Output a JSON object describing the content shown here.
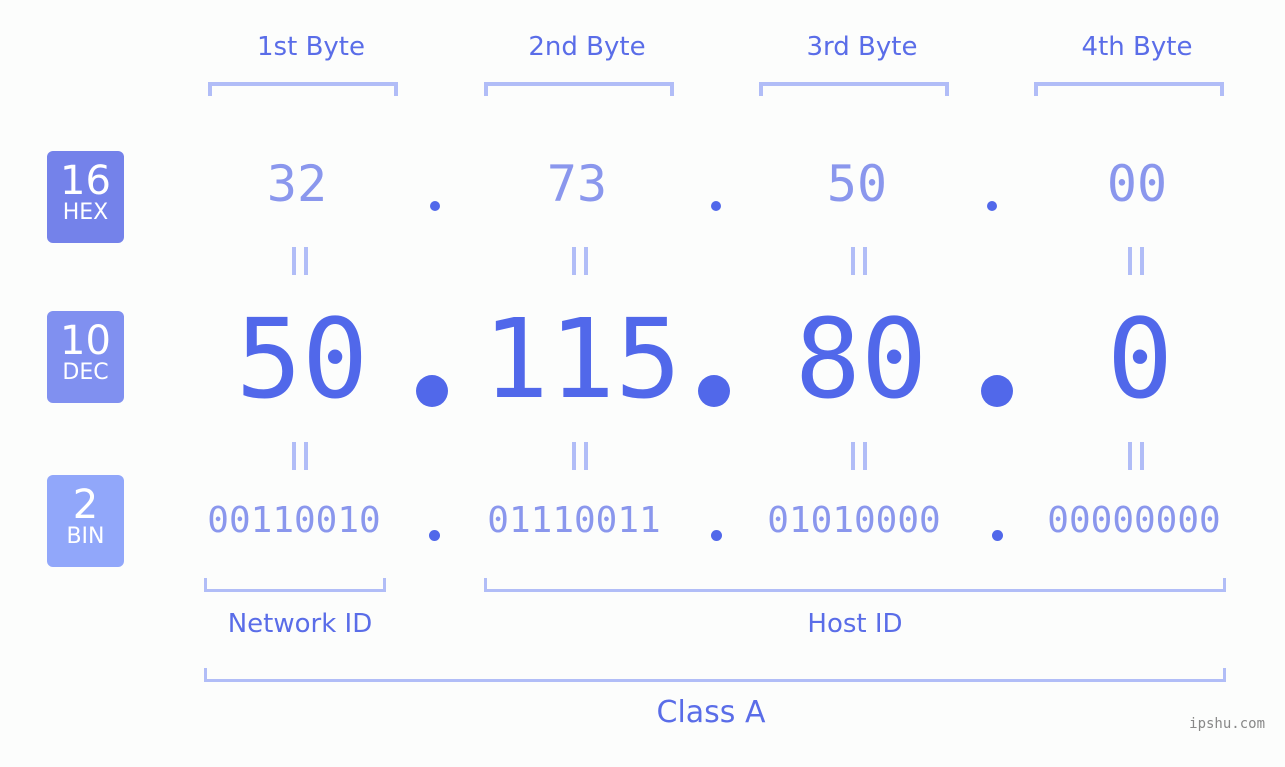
{
  "bytes": {
    "headers": [
      "1st Byte",
      "2nd Byte",
      "3rd Byte",
      "4th Byte"
    ],
    "hex": [
      "32",
      "73",
      "50",
      "00"
    ],
    "dec": [
      "50",
      "115",
      "80",
      "0"
    ],
    "bin": [
      "00110010",
      "01110011",
      "01010000",
      "00000000"
    ]
  },
  "badges": {
    "hex": {
      "num": "16",
      "label": "HEX",
      "color": "#7482ea"
    },
    "dec": {
      "num": "10",
      "label": "DEC",
      "color": "#8090f0"
    },
    "bin": {
      "num": "2",
      "label": "BIN",
      "color": "#91a7fa"
    }
  },
  "segments": {
    "network": "Network ID",
    "host": "Host ID",
    "class": "Class A"
  },
  "watermark": "ipshu.com"
}
